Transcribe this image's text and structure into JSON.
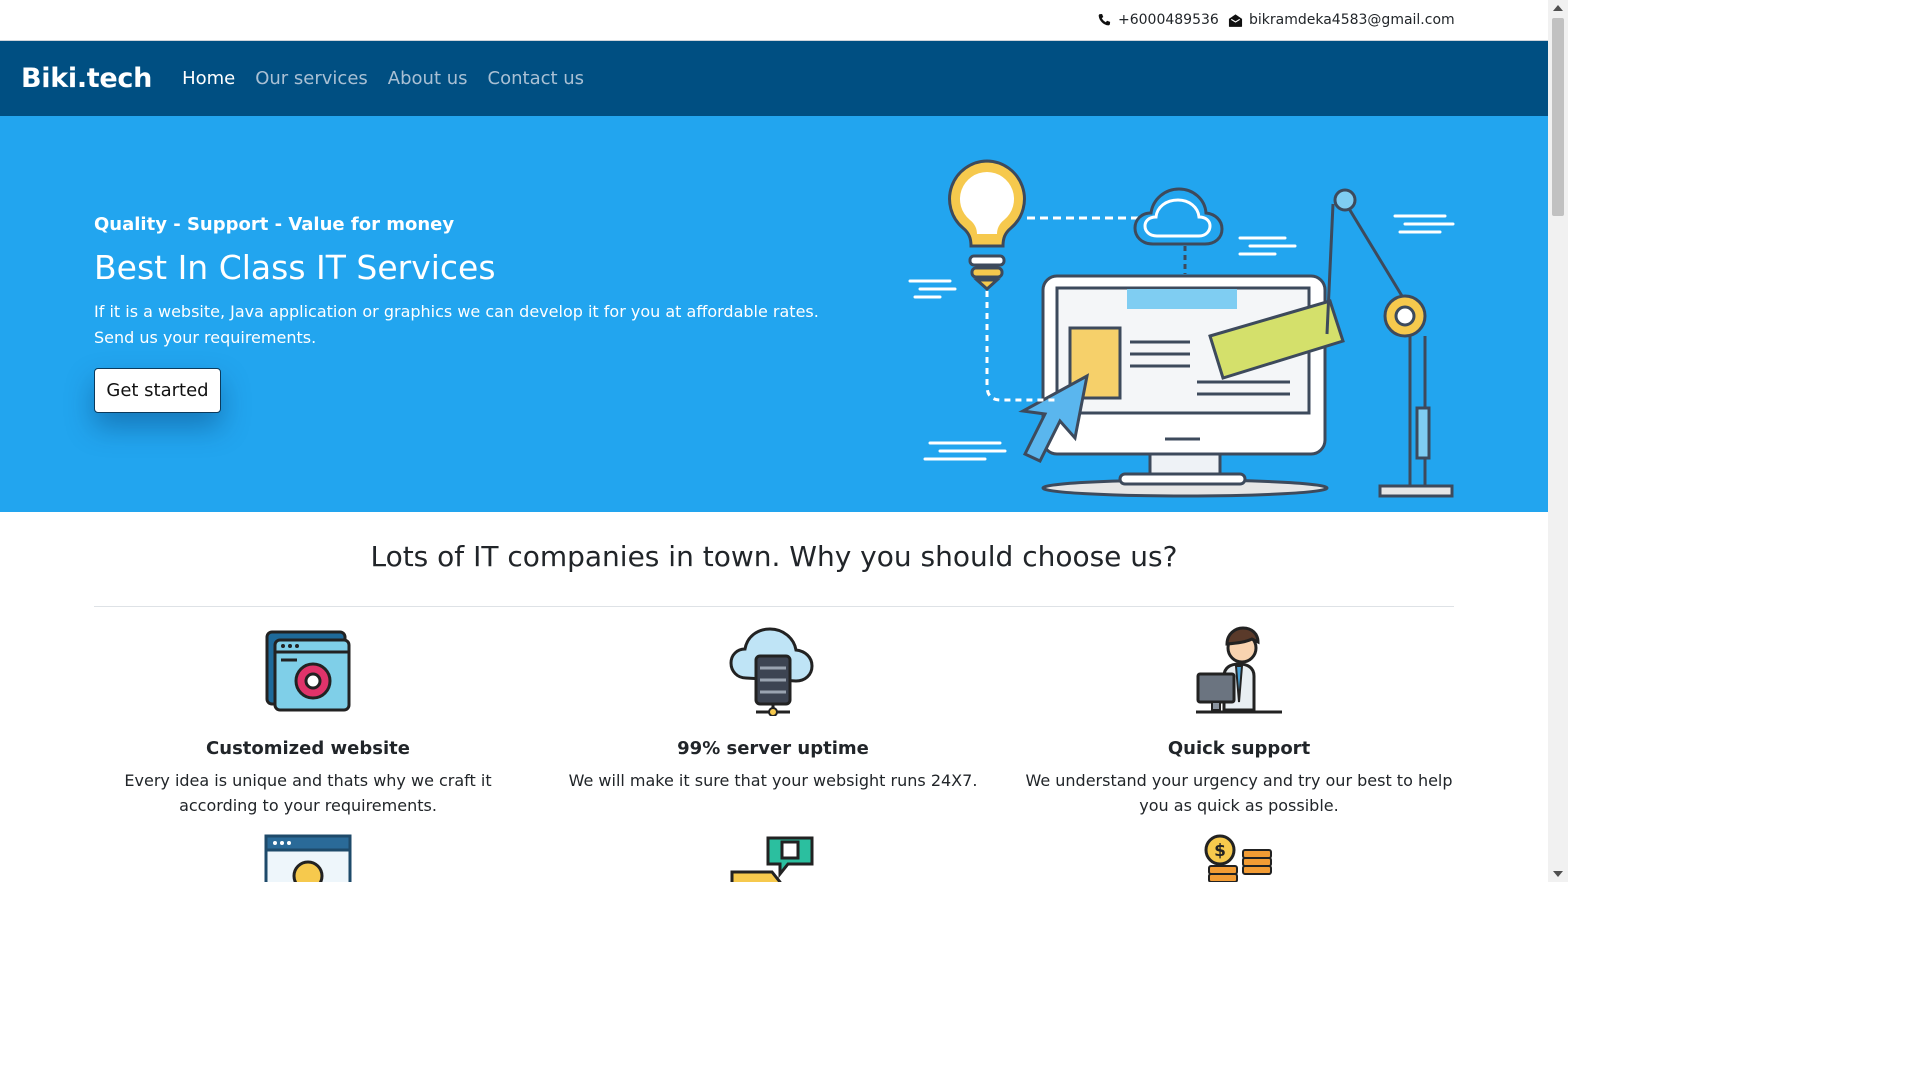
{
  "topbar": {
    "phone": "+6000489536",
    "email": "bikramdeka4583@gmail.com",
    "phone_icon": "phone-icon",
    "email_icon": "envelope-open-icon"
  },
  "navbar": {
    "brand": "Biki.tech",
    "links": [
      "Home",
      "Our services",
      "About us",
      "Contact us"
    ],
    "active_link": "Home",
    "bg_color": "#004f82"
  },
  "hero": {
    "tagline": "Quality - Support - Value for money",
    "headline": "Best In Class IT Services",
    "description": "If it is a website, Java application or graphics we can develop it for you at affordable rates. Send us your requirements.",
    "cta_label": "Get started",
    "bg_color": "#22a5ef"
  },
  "why": {
    "title": "Lots of IT companies in town. Why you should choose us?",
    "features": [
      {
        "icon": "website-gear-icon",
        "title": "Customized website",
        "desc": "Every idea is unique and thats why we craft it according to your requirements."
      },
      {
        "icon": "cloud-server-icon",
        "title": "99% server uptime",
        "desc": "We will make it sure that your websight runs 24X7."
      },
      {
        "icon": "support-agent-icon",
        "title": "Quick support",
        "desc": "We understand your urgency and try our best to help you as quick as possible."
      }
    ]
  }
}
